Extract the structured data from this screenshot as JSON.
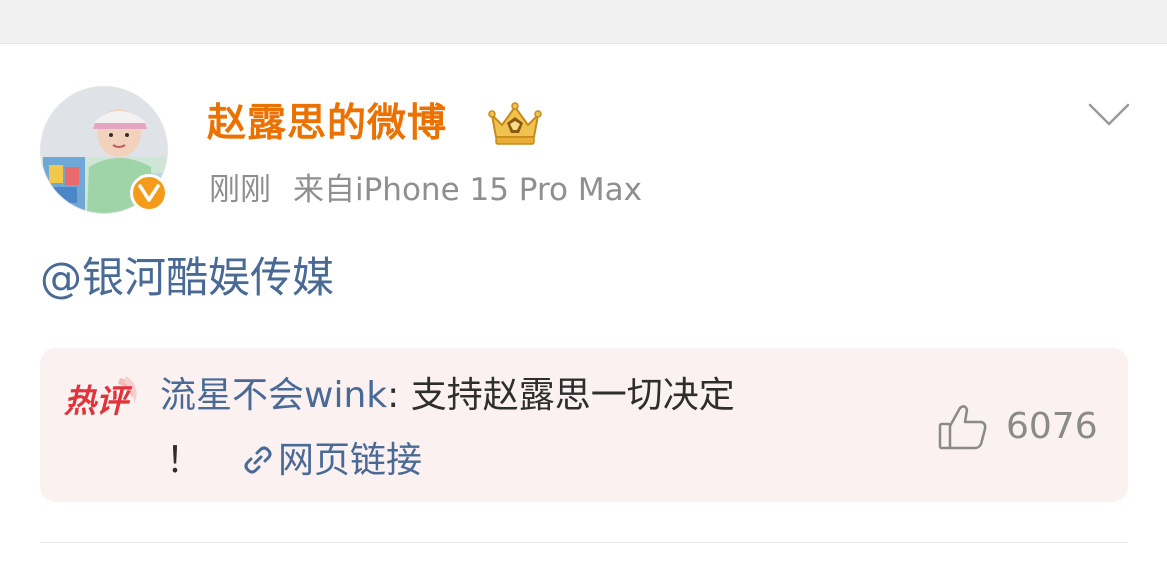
{
  "post": {
    "username": "赵露思的微博",
    "time": "刚刚",
    "source": "来自iPhone 15 Pro Max",
    "content": "@银河酷娱传媒",
    "colors": {
      "username": "#eb7100",
      "link": "#4a6a96",
      "meta": "#8f8f8f"
    }
  },
  "hot_comment": {
    "badge": "热评",
    "author": "流星不会wink",
    "separator": ": ",
    "text_line1": "支持赵露思一切决定",
    "text_line2": "！",
    "link_label": "网页链接",
    "like_count": "6076",
    "colors": {
      "badge": "#e0333a",
      "background": "#fbf1f1"
    }
  },
  "icons": {
    "verified": "verified-v-icon",
    "crown": "crown-member-icon",
    "menu": "chevron-down-icon",
    "link": "link-icon",
    "like": "thumbs-up-icon"
  }
}
